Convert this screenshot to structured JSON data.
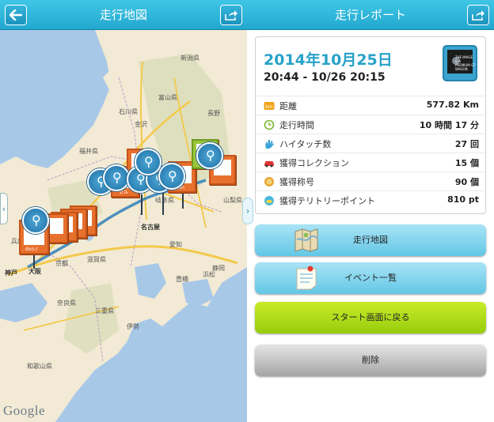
{
  "map_screen": {
    "title": "走行地図",
    "back_icon": "back-arrow-icon",
    "share_icon": "share-icon",
    "google_logo": "Google",
    "labels": [
      {
        "text": "新潟県"
      },
      {
        "text": "富山県"
      },
      {
        "text": "長野"
      },
      {
        "text": "石川県"
      },
      {
        "text": "岐阜県"
      },
      {
        "text": "福井県"
      },
      {
        "text": "山梨県"
      },
      {
        "text": "静岡"
      },
      {
        "text": "滋賀県"
      },
      {
        "text": "京都"
      },
      {
        "text": "名古屋"
      },
      {
        "text": "浜松"
      },
      {
        "text": "神戸"
      },
      {
        "text": "大阪"
      },
      {
        "text": "奈良県"
      },
      {
        "text": "三重県"
      },
      {
        "text": "和歌山県"
      },
      {
        "text": "兵庫県"
      },
      {
        "text": "愛知"
      },
      {
        "text": "豊橋"
      },
      {
        "text": "伊勢"
      },
      {
        "text": "金沢"
      }
    ],
    "marker_captions": [
      "dvn.r",
      "セル",
      "ohan"
    ]
  },
  "report_screen": {
    "title": "走行レポート",
    "back_icon": "back-arrow-icon",
    "share_icon": "share-icon",
    "date": "2014年10月25日",
    "time_range": "20:44 - 10/26 20:15",
    "thumb_text": "THE IMAGE & A PREMIUM GT WAGON",
    "rows": [
      {
        "icon": "km-icon",
        "label": "距離",
        "value": "577.82 Km"
      },
      {
        "icon": "clock-icon",
        "label": "走行時間",
        "value": "10 時間 17 分"
      },
      {
        "icon": "high-touch-icon",
        "label": "ハイタッチ数",
        "value": "27 回"
      },
      {
        "icon": "car-collection-icon",
        "label": "獲得コレクション",
        "value": "15 個"
      },
      {
        "icon": "medal-icon",
        "label": "獲得称号",
        "value": "90 個"
      },
      {
        "icon": "territory-icon",
        "label": "獲得テリトリーポイント",
        "value": "810 pt"
      }
    ],
    "buttons": {
      "map": "走行地図",
      "events": "イベント一覧",
      "back_to_start": "スタート画面に戻る",
      "delete": "削除"
    }
  },
  "colors": {
    "header": "#22a8cf",
    "date": "#27a2c8",
    "blue_button": "#63c7e6",
    "green_button": "#97cc0c",
    "gray_button": "#a5a5a5"
  }
}
